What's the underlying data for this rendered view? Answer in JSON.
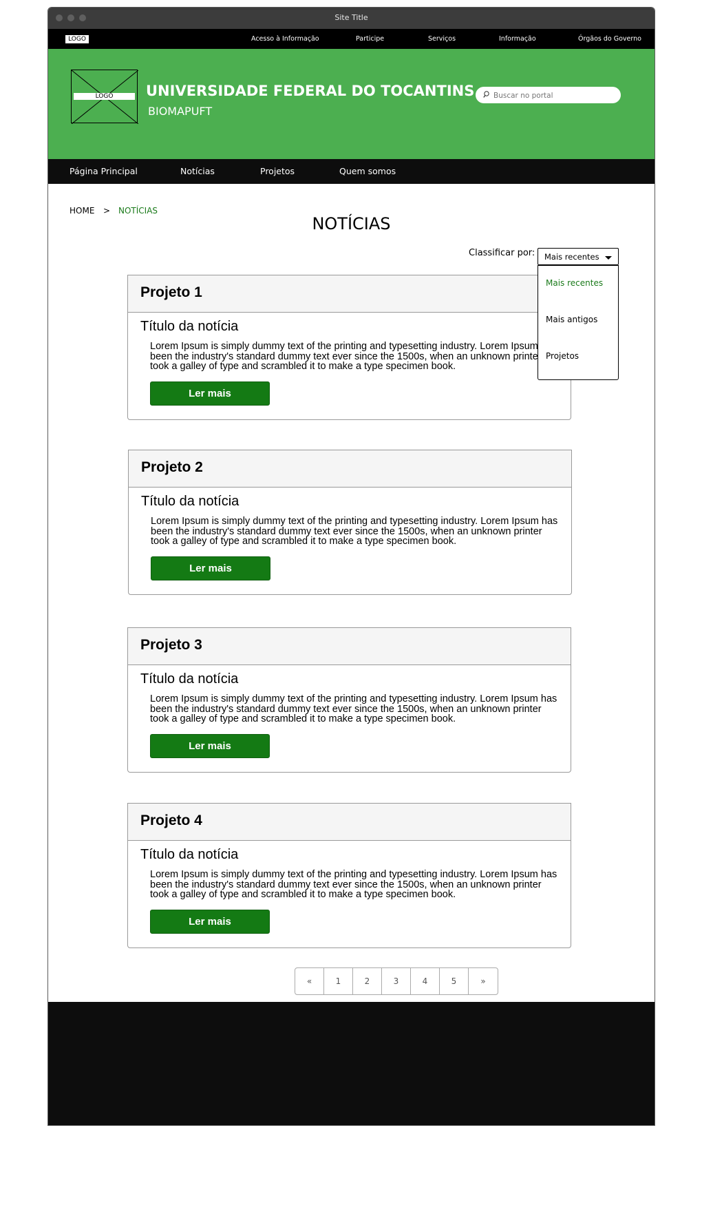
{
  "window": {
    "title": "Site Title"
  },
  "gov_bar": {
    "logo": "LOGO",
    "links": [
      "Acesso à Informação",
      "Participe",
      "Serviços",
      "Informação",
      "Órgãos do Governo"
    ]
  },
  "header": {
    "logo": "LOGO",
    "site_name": "UNIVERSIDADE FEDERAL DO TOCANTINS",
    "site_sub": "BIOMAPUFT",
    "search_placeholder": "Buscar no portal"
  },
  "nav": {
    "items": [
      "Página Principal",
      "Notícias",
      "Projetos",
      "Quem somos"
    ]
  },
  "breadcrumb": {
    "home": "HOME",
    "separator": ">",
    "current": "NOTÍCIAS"
  },
  "page_title": "NOTÍCIAS",
  "sort": {
    "label": "Classificar por:",
    "selected": "Mais recentes",
    "options": [
      "Mais recentes",
      "Mais antigos",
      "Projetos"
    ]
  },
  "cards": [
    {
      "project": "Projeto 1",
      "title": "Título da notícia",
      "body": "Lorem Ipsum is simply dummy text of the printing and typesetting industry. Lorem Ipsum has been the industry's standard dummy text ever since the 1500s, when an unknown printer took a galley of type and scrambled it to make a type specimen book.",
      "button": "Ler mais"
    },
    {
      "project": "Projeto 2",
      "title": "Título da notícia",
      "body": "Lorem Ipsum is simply dummy text of the printing and typesetting industry. Lorem Ipsum has been the industry's standard dummy text ever since the 1500s, when an unknown printer took a galley of type and scrambled it to make a type specimen book.",
      "button": "Ler mais"
    },
    {
      "project": "Projeto 3",
      "title": "Título da notícia",
      "body": "Lorem Ipsum is simply dummy text of the printing and typesetting industry. Lorem Ipsum has been the industry's standard dummy text ever since the 1500s, when an unknown printer took a galley of type and scrambled it to make a type specimen book.",
      "button": "Ler mais"
    },
    {
      "project": "Projeto 4",
      "title": "Título da notícia",
      "body": "Lorem Ipsum is simply dummy text of the printing and typesetting industry. Lorem Ipsum has been the industry's standard dummy text ever since the 1500s, when an unknown printer took a galley of type and scrambled it to make a type specimen book.",
      "button": "Ler mais"
    }
  ],
  "pagination": {
    "prev": "«",
    "pages": [
      "1",
      "2",
      "3",
      "4",
      "5"
    ],
    "next": "»"
  },
  "colors": {
    "header_green": "#4caf50",
    "button_green": "#147a14",
    "active_green": "#1a7a1a",
    "bar_black": "#0d0d0d"
  }
}
